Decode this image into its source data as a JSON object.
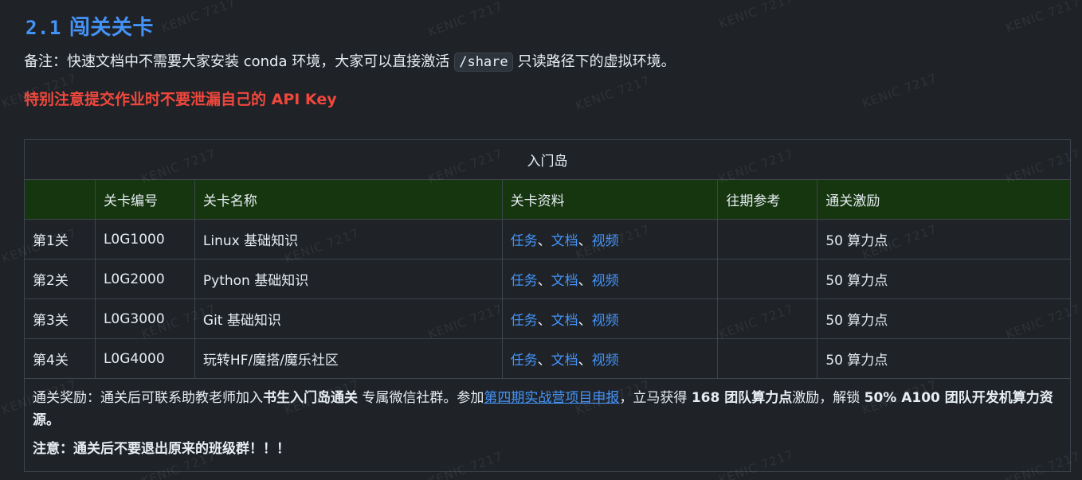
{
  "section": {
    "number": "2.1",
    "title": "闯关关卡"
  },
  "note": {
    "prefix": "备注：快速文档中不需要大家安装 conda 环境，大家可以直接激活",
    "code": "/share",
    "suffix": "只读路径下的虚拟环境。"
  },
  "warning": "特别注意提交作业时不要泄漏自己的 API Key",
  "table": {
    "caption": "入门岛",
    "headers": [
      "",
      "关卡编号",
      "关卡名称",
      "关卡资料",
      "往期参考",
      "通关激励"
    ],
    "rows": [
      {
        "stage": "第1关",
        "code": "L0G1000",
        "name": "Linux 基础知识",
        "task": "任务",
        "doc": "文档",
        "video": "视频",
        "ref": "",
        "reward": "50 算力点"
      },
      {
        "stage": "第2关",
        "code": "L0G2000",
        "name": "Python 基础知识",
        "task": "任务",
        "doc": "文档",
        "video": "视频",
        "ref": "",
        "reward": "50 算力点"
      },
      {
        "stage": "第3关",
        "code": "L0G3000",
        "name": "Git 基础知识",
        "task": "任务",
        "doc": "文档",
        "video": "视频",
        "ref": "",
        "reward": "50 算力点"
      },
      {
        "stage": "第4关",
        "code": "L0G4000",
        "name": "玩转HF/魔搭/魔乐社区",
        "task": "任务",
        "doc": "文档",
        "video": "视频",
        "ref": "",
        "reward": "50 算力点"
      }
    ],
    "link_sep": "、",
    "footer": {
      "p1_a": "通关奖励：通关后可联系助教老师加入",
      "p1_b": "书生入门岛通关",
      "p1_c": "专属微信社群。参加",
      "p1_link": "第四期实战营项目申报",
      "p1_d": "，立马获得",
      "p1_e": "168 团队算力点",
      "p1_f": "激励，解锁",
      "p1_g": "50% A100 团队开发机算力资源。",
      "p2": "注意：通关后不要退出原来的班级群！！！"
    }
  },
  "watermark": "KENIC 7217"
}
